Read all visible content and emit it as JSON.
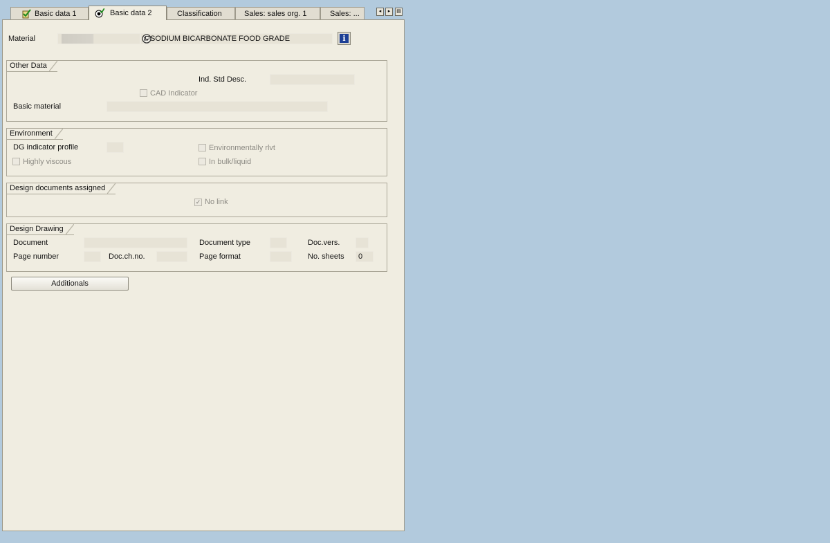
{
  "tabs": [
    {
      "label": "Basic data 1",
      "icon": "check-doc-icon",
      "active": false
    },
    {
      "label": "Basic data 2",
      "icon": "check-doc-icon",
      "active": true
    },
    {
      "label": "Classification",
      "active": false
    },
    {
      "label": "Sales: sales org. 1",
      "active": false
    },
    {
      "label": "Sales: ...",
      "active": false
    }
  ],
  "tab_nav": {
    "prev": "◂",
    "next": "▸",
    "list": "▤"
  },
  "header": {
    "material_label": "Material",
    "material_description": "SODIUM BICARBONATE FOOD GRADE"
  },
  "other_data": {
    "title": "Other Data",
    "ind_std_desc_label": "Ind. Std Desc.",
    "cad_indicator_label": "CAD Indicator",
    "basic_material_label": "Basic material"
  },
  "environment": {
    "title": "Environment",
    "dg_indicator_label": "DG indicator profile",
    "env_relevant_label": "Environmentally rlvt",
    "highly_viscous_label": "Highly viscous",
    "in_bulk_label": "In bulk/liquid"
  },
  "design_docs": {
    "title": "Design documents assigned",
    "no_link_label": "No link",
    "no_link_checked": true
  },
  "design_drawing": {
    "title": "Design Drawing",
    "document_label": "Document",
    "document_type_label": "Document type",
    "doc_vers_label": "Doc.vers.",
    "page_number_label": "Page number",
    "doc_ch_no_label": "Doc.ch.no.",
    "page_format_label": "Page format",
    "no_sheets_label": "No. sheets",
    "no_sheets_value": "0"
  },
  "buttons": {
    "additionals": "Additionals"
  },
  "colors": {
    "desktop_bg": "#b2cadd",
    "panel_bg": "#f0ede1",
    "info_button": "#1d3f95"
  }
}
